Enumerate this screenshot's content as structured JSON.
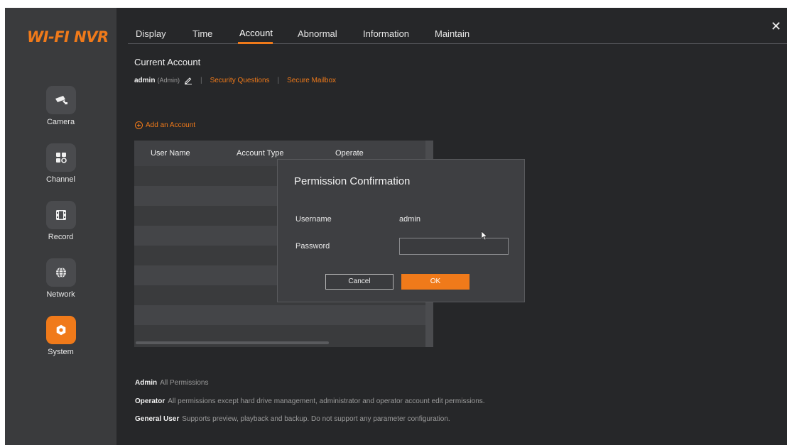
{
  "app": {
    "logo": "WI-FI NVR",
    "accent_color": "#f07a1a"
  },
  "sidebar": {
    "items": [
      {
        "label": "Camera",
        "icon": "camera-icon"
      },
      {
        "label": "Channel",
        "icon": "channel-grid-icon"
      },
      {
        "label": "Record",
        "icon": "record-film-icon"
      },
      {
        "label": "Network",
        "icon": "globe-icon"
      },
      {
        "label": "System",
        "icon": "gear-icon",
        "active": true
      }
    ]
  },
  "tabs": [
    {
      "label": "Display"
    },
    {
      "label": "Time"
    },
    {
      "label": "Account",
      "active": true
    },
    {
      "label": "Abnormal"
    },
    {
      "label": "Information"
    },
    {
      "label": "Maintain"
    }
  ],
  "close_icon": "close-icon",
  "current_account": {
    "title": "Current Account",
    "username": "admin",
    "role": "(Admin)",
    "security_questions": "Security Questions",
    "secure_mailbox": "Secure Mailbox"
  },
  "add_account": "Add an Account",
  "table": {
    "headers": [
      "User Name",
      "Account Type",
      "Operate"
    ]
  },
  "modal": {
    "title": "Permission Confirmation",
    "username_label": "Username",
    "username_value": "admin",
    "password_label": "Password",
    "password_value": "",
    "cancel": "Cancel",
    "ok": "OK"
  },
  "permissions": [
    {
      "role": "Admin",
      "desc": "All Permissions"
    },
    {
      "role": "Operator",
      "desc": "All permissions except hard drive management, administrator and operator account edit permissions."
    },
    {
      "role": "General User",
      "desc": "Supports preview, playback and backup. Do not support any parameter configuration."
    }
  ]
}
